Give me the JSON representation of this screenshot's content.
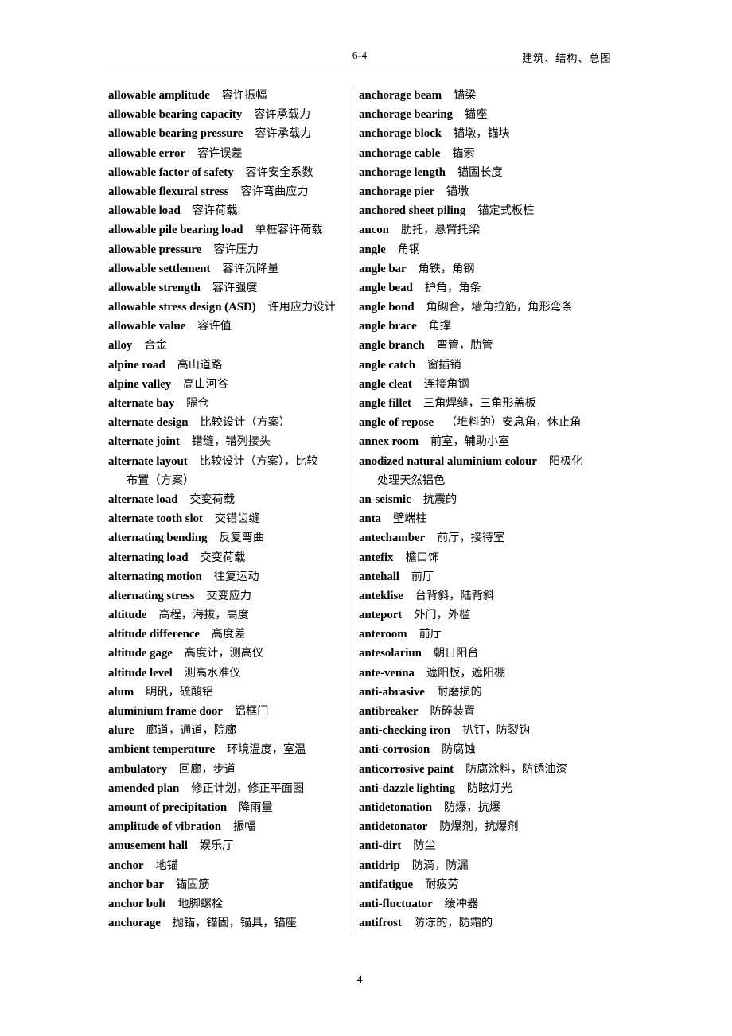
{
  "header": {
    "folio": "6-4",
    "section": "建筑、结构、总图"
  },
  "footer": {
    "page_number": "4"
  },
  "columns": {
    "left": [
      {
        "term": "allowable amplitude",
        "gap": "m",
        "gloss": "容许振幅"
      },
      {
        "term": "allowable bearing capacity",
        "gap": "m",
        "gloss": "容许承载力"
      },
      {
        "term": "allowable bearing pressure",
        "gap": "m",
        "gloss": "容许承载力"
      },
      {
        "term": "allowable error",
        "gap": "m",
        "gloss": "容许误差"
      },
      {
        "term": "allowable factor of safety",
        "gap": "m",
        "gloss": "容许安全系数"
      },
      {
        "term": "allowable flexural stress",
        "gap": "m",
        "gloss": "容许弯曲应力"
      },
      {
        "term": "allowable load",
        "gap": "m",
        "gloss": "容许荷载"
      },
      {
        "term": "allowable pile bearing load",
        "gap": "m",
        "gloss": "单桩容许荷载"
      },
      {
        "term": "allowable pressure",
        "gap": "m",
        "gloss": "容许压力"
      },
      {
        "term": "allowable settlement",
        "gap": "m",
        "gloss": "容许沉降量"
      },
      {
        "term": "allowable strength",
        "gap": "m",
        "gloss": "容许强度"
      },
      {
        "term": "allowable stress design (ASD)",
        "gap": "m",
        "gloss": "许用应力设计"
      },
      {
        "term": "allowable value",
        "gap": "m",
        "gloss": "容许值"
      },
      {
        "term": "alloy",
        "gap": "m",
        "gloss": "合金"
      },
      {
        "term": "alpine road",
        "gap": "m",
        "gloss": "高山道路"
      },
      {
        "term": "alpine valley",
        "gap": "m",
        "gloss": "高山河谷"
      },
      {
        "term": "alternate bay",
        "gap": "m",
        "gloss": "隔仓"
      },
      {
        "term": "alternate design",
        "gap": "m",
        "gloss": "比较设计（方案）"
      },
      {
        "term": "alternate joint",
        "gap": "m",
        "gloss": "错缝，错列接头"
      },
      {
        "term": "alternate layout",
        "gap": "m",
        "gloss": "比较设计（方案），比较"
      },
      {
        "continuation": true,
        "gloss": "布置（方案）"
      },
      {
        "term": "alternate load",
        "gap": "m",
        "gloss": "交变荷载"
      },
      {
        "term": "alternate tooth slot",
        "gap": "m",
        "gloss": "交错齿缝"
      },
      {
        "term": "alternating bending",
        "gap": "m",
        "gloss": "反复弯曲"
      },
      {
        "term": "alternating load",
        "gap": "m",
        "gloss": "交变荷载"
      },
      {
        "term": "alternating motion",
        "gap": "m",
        "gloss": "往复运动"
      },
      {
        "term": "alternating stress",
        "gap": "m",
        "gloss": "交变应力"
      },
      {
        "term": "altitude",
        "gap": "m",
        "gloss": "高程，海拔，高度"
      },
      {
        "term": "altitude difference",
        "gap": "m",
        "gloss": "高度差"
      },
      {
        "term": "altitude gage",
        "gap": "m",
        "gloss": "高度计，测高仪"
      },
      {
        "term": "altitude level",
        "gap": "m",
        "gloss": "测高水准仪"
      },
      {
        "term": "alum",
        "gap": "m",
        "gloss": "明矾，硫酸铝"
      },
      {
        "term": "aluminium frame door",
        "gap": "m",
        "gloss": "铝框门"
      },
      {
        "term": "alure",
        "gap": "m",
        "gloss": "廊道，通道，院廊"
      },
      {
        "term": "ambient temperature",
        "gap": "m",
        "gloss": "环境温度，室温"
      },
      {
        "term": "ambulatory",
        "gap": "m",
        "gloss": "回廊，步道"
      },
      {
        "term": "amended plan",
        "gap": "m",
        "gloss": "修正计划，修正平面图"
      },
      {
        "term": "amount of precipitation",
        "gap": "m",
        "gloss": "降雨量"
      },
      {
        "term": "amplitude of vibration",
        "gap": "m",
        "gloss": "振幅"
      },
      {
        "term": "amusement hall",
        "gap": "m",
        "gloss": "娱乐厅"
      },
      {
        "term": "anchor",
        "gap": "m",
        "gloss": "地锚"
      },
      {
        "term": "anchor bar",
        "gap": "m",
        "gloss": "锚固筋"
      },
      {
        "term": "anchor bolt",
        "gap": "m",
        "gloss": "地脚螺栓"
      },
      {
        "term": "anchorage",
        "gap": "m",
        "gloss": "抛锚，锚固，锚具，锚座"
      }
    ],
    "right": [
      {
        "term": "anchorage beam",
        "gap": "m",
        "gloss": "锚梁"
      },
      {
        "term": "anchorage bearing",
        "gap": "m",
        "gloss": "锚座"
      },
      {
        "term": "anchorage block",
        "gap": "m",
        "gloss": "锚墩，锚块"
      },
      {
        "term": "anchorage cable",
        "gap": "m",
        "gloss": "锚索"
      },
      {
        "term": "anchorage length",
        "gap": "m",
        "gloss": "锚固长度"
      },
      {
        "term": "anchorage pier",
        "gap": "m",
        "gloss": "锚墩"
      },
      {
        "term": "anchored sheet piling",
        "gap": "m",
        "gloss": "锚定式板桩"
      },
      {
        "term": "ancon",
        "gap": "m",
        "gloss": "肋托，悬臂托梁"
      },
      {
        "term": "angle",
        "gap": "m",
        "gloss": "角钢"
      },
      {
        "term": "angle bar",
        "gap": "m",
        "gloss": "角铁，角钢"
      },
      {
        "term": "angle bead",
        "gap": "m",
        "gloss": "护角，角条"
      },
      {
        "term": "angle bond",
        "gap": "m",
        "gloss": "角砌合，墙角拉筋，角形弯条"
      },
      {
        "term": "angle brace",
        "gap": "m",
        "gloss": "角撑"
      },
      {
        "term": "angle branch",
        "gap": "m",
        "gloss": "弯管，肋管"
      },
      {
        "term": "angle catch",
        "gap": "m",
        "gloss": "窗插销"
      },
      {
        "term": "angle cleat",
        "gap": "m",
        "gloss": "连接角钢"
      },
      {
        "term": "angle fillet",
        "gap": "m",
        "gloss": "三角焊缝，三角形盖板"
      },
      {
        "term": "angle of repose",
        "gap": "m",
        "gloss": "（堆料的）安息角，休止角"
      },
      {
        "term": "annex room",
        "gap": "m",
        "gloss": "前室，辅助小室"
      },
      {
        "term": "anodized natural aluminium colour",
        "gap": "m",
        "gloss": "阳极化"
      },
      {
        "continuation": true,
        "gloss": "处理天然铝色"
      },
      {
        "term": "an-seismic",
        "gap": "m",
        "gloss": "抗震的"
      },
      {
        "term": "anta",
        "gap": "m",
        "gloss": "壁端柱"
      },
      {
        "term": "antechamber",
        "gap": "m",
        "gloss": "前厅，接待室"
      },
      {
        "term": "antefix",
        "gap": "m",
        "gloss": "檐口饰"
      },
      {
        "term": "antehall",
        "gap": "m",
        "gloss": "前厅"
      },
      {
        "term": "anteklise",
        "gap": "m",
        "gloss": "台背斜，陆背斜"
      },
      {
        "term": "anteport",
        "gap": "m",
        "gloss": "外门，外槛"
      },
      {
        "term": "anteroom",
        "gap": "m",
        "gloss": "前厅"
      },
      {
        "term": "antesolariun",
        "gap": "m",
        "gloss": "朝日阳台"
      },
      {
        "term": "ante-venna",
        "gap": "m",
        "gloss": "遮阳板，遮阳棚"
      },
      {
        "term": "anti-abrasive",
        "gap": "m",
        "gloss": "耐磨损的"
      },
      {
        "term": "antibreaker",
        "gap": "m",
        "gloss": "防碎装置"
      },
      {
        "term": "anti-checking iron",
        "gap": "m",
        "gloss": "扒钉，防裂钩"
      },
      {
        "term": "anti-corrosion",
        "gap": "m",
        "gloss": "防腐蚀"
      },
      {
        "term": "anticorrosive paint",
        "gap": "m",
        "gloss": "防腐涂料，防锈油漆"
      },
      {
        "term": "anti-dazzle lighting",
        "gap": "m",
        "gloss": "防眩灯光"
      },
      {
        "term": "antidetonation",
        "gap": "m",
        "gloss": "防爆，抗爆"
      },
      {
        "term": "antidetonator",
        "gap": "m",
        "gloss": "防爆剂，抗爆剂"
      },
      {
        "term": "anti-dirt",
        "gap": "m",
        "gloss": "防尘"
      },
      {
        "term": "antidrip",
        "gap": "m",
        "gloss": "防滴，防漏"
      },
      {
        "term": "antifatigue",
        "gap": "m",
        "gloss": "耐疲劳"
      },
      {
        "term": "anti-fluctuator",
        "gap": "m",
        "gloss": "缓冲器"
      },
      {
        "term": "antifrost",
        "gap": "m",
        "gloss": "防冻的，防霜的"
      }
    ]
  }
}
